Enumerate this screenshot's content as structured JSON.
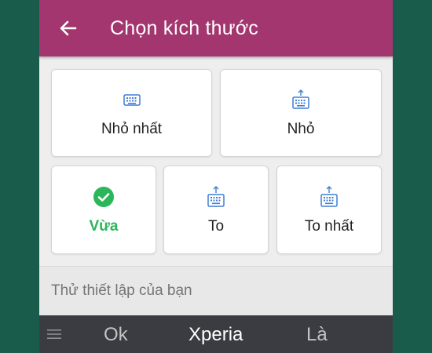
{
  "appbar": {
    "title": "Chọn kích thước",
    "back_icon": "arrow-left-icon",
    "background": "#a3366e"
  },
  "options": [
    {
      "label": "Nhỏ nhất",
      "icon": "keyboard-icon",
      "selected": false
    },
    {
      "label": "Nhỏ",
      "icon": "keyboard-expand-icon",
      "selected": false
    },
    {
      "label": "Vừa",
      "icon": "check-circle-icon",
      "selected": true
    },
    {
      "label": "To",
      "icon": "keyboard-expand-icon",
      "selected": false
    },
    {
      "label": "To nhất",
      "icon": "keyboard-expand-icon",
      "selected": false
    }
  ],
  "trial": {
    "placeholder": "Thử thiết lập của bạn"
  },
  "suggestions": {
    "menu_icon": "menu-icon",
    "items": [
      "Ok",
      "Xperia",
      "Là"
    ]
  },
  "colors": {
    "accent": "#2bb65a",
    "icon_blue": "#3f7fd6",
    "page_bg": "#1a5c4c"
  }
}
